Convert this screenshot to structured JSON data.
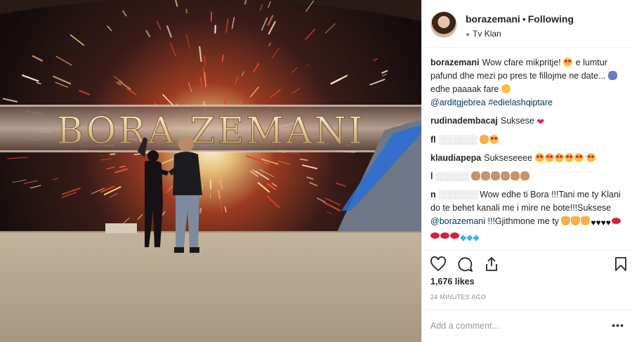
{
  "header": {
    "username": "borazemani",
    "separator": "•",
    "follow_state": "Following",
    "location": "Tv Klan"
  },
  "photo": {
    "banner_text": "BORA ZEMANI"
  },
  "caption": {
    "username": "borazemani",
    "text_1": "Wow cfare mikpritje!",
    "text_2": "e lumtur pafund dhe mezi po pres te fillojme ne date...",
    "text_3": "edhe paaaak fare",
    "mention_1": "@arditgjebrea",
    "hashtag_1": "#edielashqiptare"
  },
  "comments": [
    {
      "username": "rudinadembacaj",
      "text": "Suksese"
    },
    {
      "username": "fl",
      "text": ""
    },
    {
      "username": "klaudiapepa",
      "text": "Sukseseeee"
    },
    {
      "username": "l",
      "text": ""
    },
    {
      "username": "n",
      "text_1": "Wow edhe ti Bora !!!Tani me ty Klani do te behet kanali me i mire ne bote!!!Suksese",
      "mention": "@borazemani",
      "text_2": "!!!Gjithmone me ty"
    }
  ],
  "actions": {
    "like_icon": "heart-icon",
    "comment_icon": "comment-bubble-icon",
    "share_icon": "share-icon",
    "save_icon": "bookmark-icon"
  },
  "likes_text": "1,676 likes",
  "timestamp": "24 MINUTES AGO",
  "add_comment": {
    "placeholder": "Add a comment...",
    "more_label": "•••"
  },
  "colors": {
    "text": "#262626",
    "secondary": "#8e8e8e",
    "link": "#003569",
    "border": "#efefef",
    "heart": "#e0245e"
  }
}
